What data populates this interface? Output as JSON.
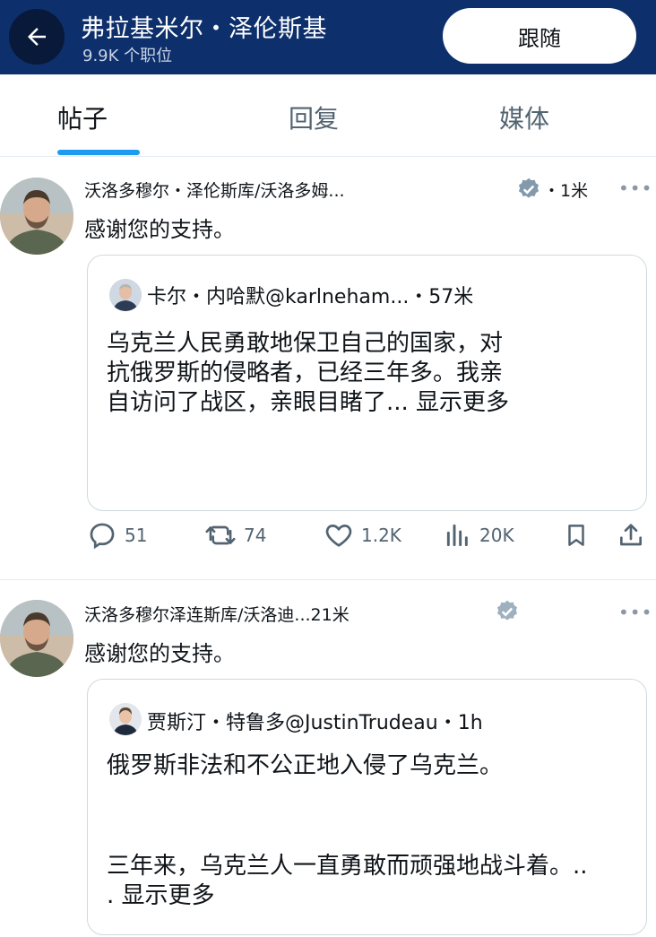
{
  "header": {
    "title": "弗拉基米尔・泽伦斯基",
    "subtitle": "9.9K 个职位",
    "follow_label": "跟随"
  },
  "tabs": [
    {
      "label": "帖子",
      "active": true
    },
    {
      "label": "回复",
      "active": false
    },
    {
      "label": "媒体",
      "active": false
    }
  ],
  "posts": [
    {
      "author": "沃洛多穆尔・泽伦斯库/沃洛多姆...",
      "time": "・1米",
      "text": "感谢您的支持。",
      "quote": {
        "author": "卡尔・内哈默@karlneham...・57米",
        "lines": [
          "乌克兰人民勇敢地保卫自己的国家，对",
          "抗俄罗斯的侵略者，已经三年多。我亲",
          "自访问了战区，亲眼目睹了... 显示更多"
        ]
      },
      "actions": {
        "replies": "51",
        "reposts": "74",
        "likes": "1.2K",
        "views": "20K"
      }
    },
    {
      "author": "沃洛多穆尔泽连斯库/沃洛迪...21米",
      "text": "感谢您的支持。",
      "quote": {
        "author": "贾斯汀・特鲁多@JustinTrudeau・1h",
        "lines": [
          "俄罗斯非法和不公正地入侵了乌克兰。",
          "三年来，乌克兰人一直勇敢而顽强地战斗着。..",
          ". 显示更多"
        ]
      }
    }
  ],
  "colors": {
    "header_bg": "#0d2f6b",
    "accent": "#1d9bf0",
    "muted": "#536471",
    "verified": "#829aab"
  },
  "icons": [
    "back-arrow-icon",
    "verified-badge-icon",
    "more-icon",
    "reply-icon",
    "repost-icon",
    "like-icon",
    "views-icon",
    "bookmark-icon",
    "share-icon"
  ]
}
